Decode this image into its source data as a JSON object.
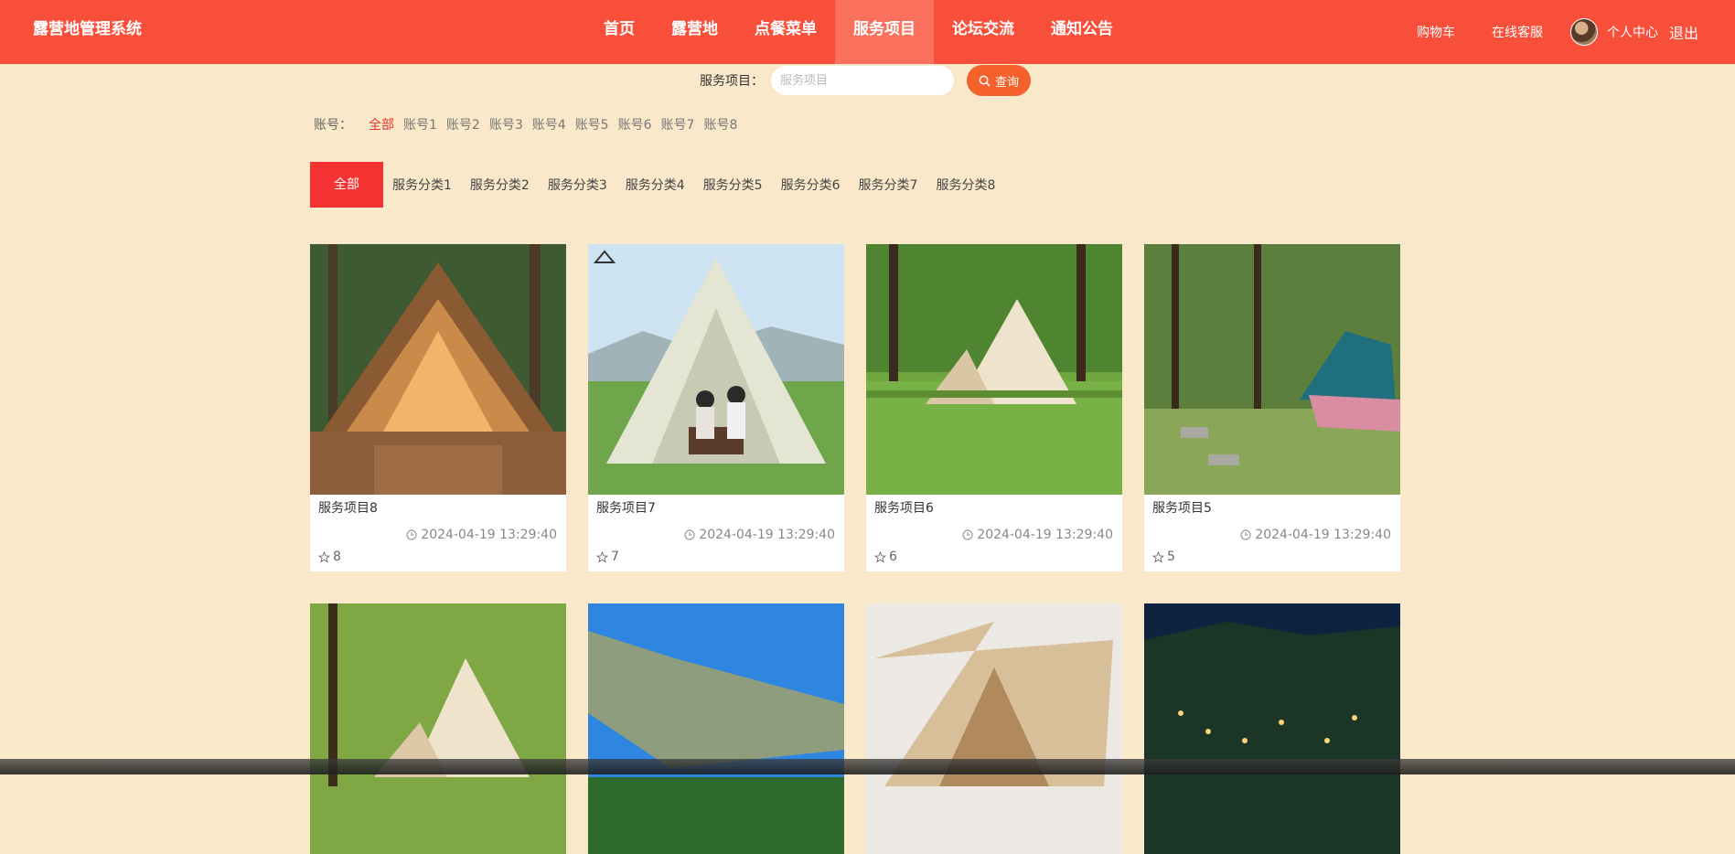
{
  "header": {
    "brand": "露营地管理系统",
    "nav": [
      "首页",
      "露营地",
      "点餐菜单",
      "服务项目",
      "论坛交流",
      "通知公告"
    ],
    "active_nav": 3,
    "cart": "购物车",
    "service": "在线客服",
    "profile": "个人中心",
    "logout": "退出"
  },
  "search": {
    "label": "服务项目：",
    "placeholder": "服务项目",
    "button": "查询"
  },
  "account_filter": {
    "label": "账号：",
    "options": [
      "全部",
      "账号1",
      "账号2",
      "账号3",
      "账号4",
      "账号5",
      "账号6",
      "账号7",
      "账号8"
    ]
  },
  "category_tabs": [
    "全部",
    "服务分类1",
    "服务分类2",
    "服务分类3",
    "服务分类4",
    "服务分类5",
    "服务分类6",
    "服务分类7",
    "服务分类8"
  ],
  "cards": [
    {
      "title": "服务项目8",
      "time": "2024-04-19 13:29:40",
      "stars": "8"
    },
    {
      "title": "服务项目7",
      "time": "2024-04-19 13:29:40",
      "stars": "7"
    },
    {
      "title": "服务项目6",
      "time": "2024-04-19 13:29:40",
      "stars": "6"
    },
    {
      "title": "服务项目5",
      "time": "2024-04-19 13:29:40",
      "stars": "5"
    }
  ],
  "colors": {
    "header": "#f84f3b",
    "page_bg": "#f9e8c9",
    "accent": "#f53232",
    "search_button": "#f5612a"
  }
}
